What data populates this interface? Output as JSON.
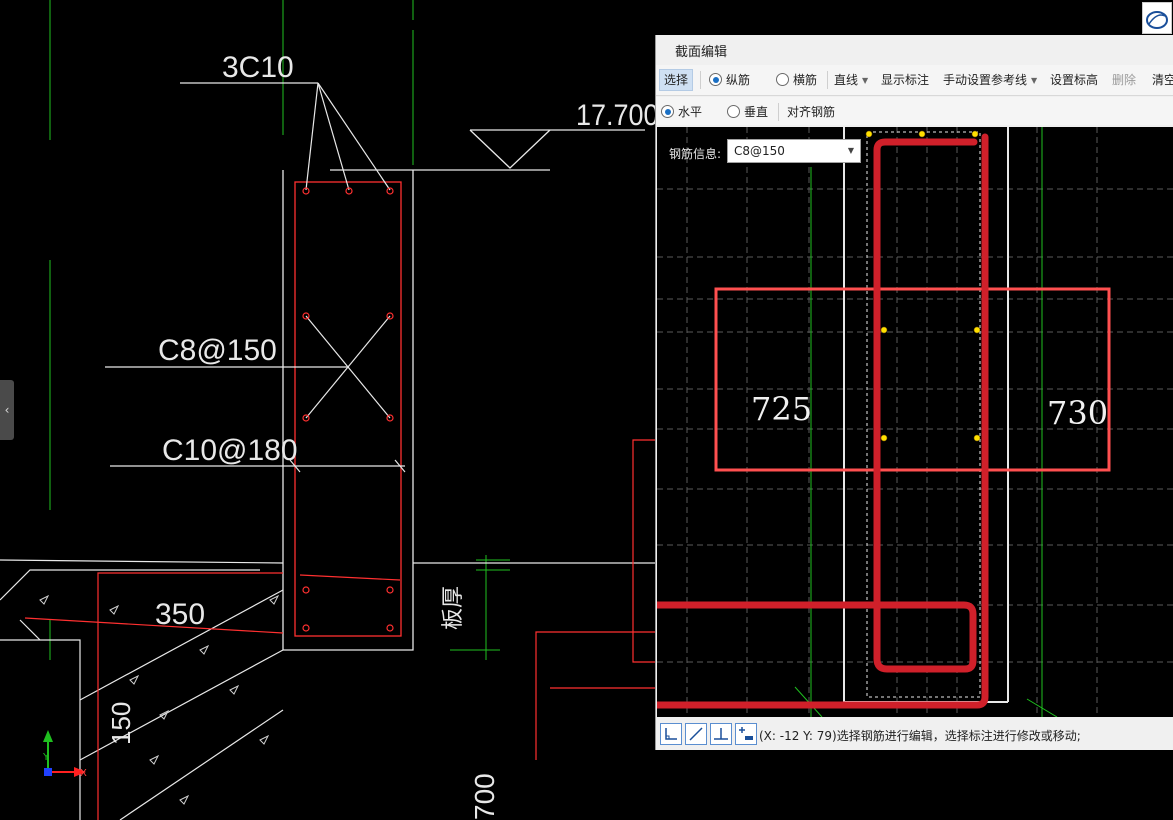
{
  "drawing": {
    "labels": {
      "top_rebar": "3C10",
      "elevation": "17.700",
      "stirrup": "C8@150",
      "side_rebar": "C10@180",
      "slab_width": "350",
      "slab_thick": "150",
      "vertical_label": "板厚",
      "bottom_dim": "700"
    },
    "axis": {
      "x": "X",
      "y": "Y"
    },
    "side_tab_glyph": "‹"
  },
  "panel": {
    "title": "截面编辑",
    "toolbar1": {
      "select": "选择",
      "longitudinal": "纵筋",
      "transverse": "横筋",
      "line": "直线",
      "show_dims": "显示标注",
      "manual_ref": "手动设置参考线",
      "set_elev": "设置标高",
      "delete": "删除",
      "clear": "清空"
    },
    "toolbar2": {
      "horizontal": "水平",
      "vertical": "垂直",
      "align": "对齐钢筋"
    },
    "rebar_info": {
      "label": "钢筋信息:",
      "value": "C8@150"
    },
    "section_dims": {
      "left": "725",
      "right": "730"
    },
    "status": "(X: -12 Y: 79)选择钢筋进行编辑，选择标注进行修改或移动;"
  },
  "colors": {
    "rebar_red": "#d0202a",
    "cad_red": "#ff3030",
    "grid_green": "#1fbf1f",
    "handle_yellow": "#ffe000",
    "toolbar_active": "#cfe0f3"
  },
  "icons": [
    "mode-orthogonal-icon",
    "mode-line-icon",
    "mode-perpendicular-icon",
    "mode-add-icon",
    "corner-app-icon"
  ]
}
